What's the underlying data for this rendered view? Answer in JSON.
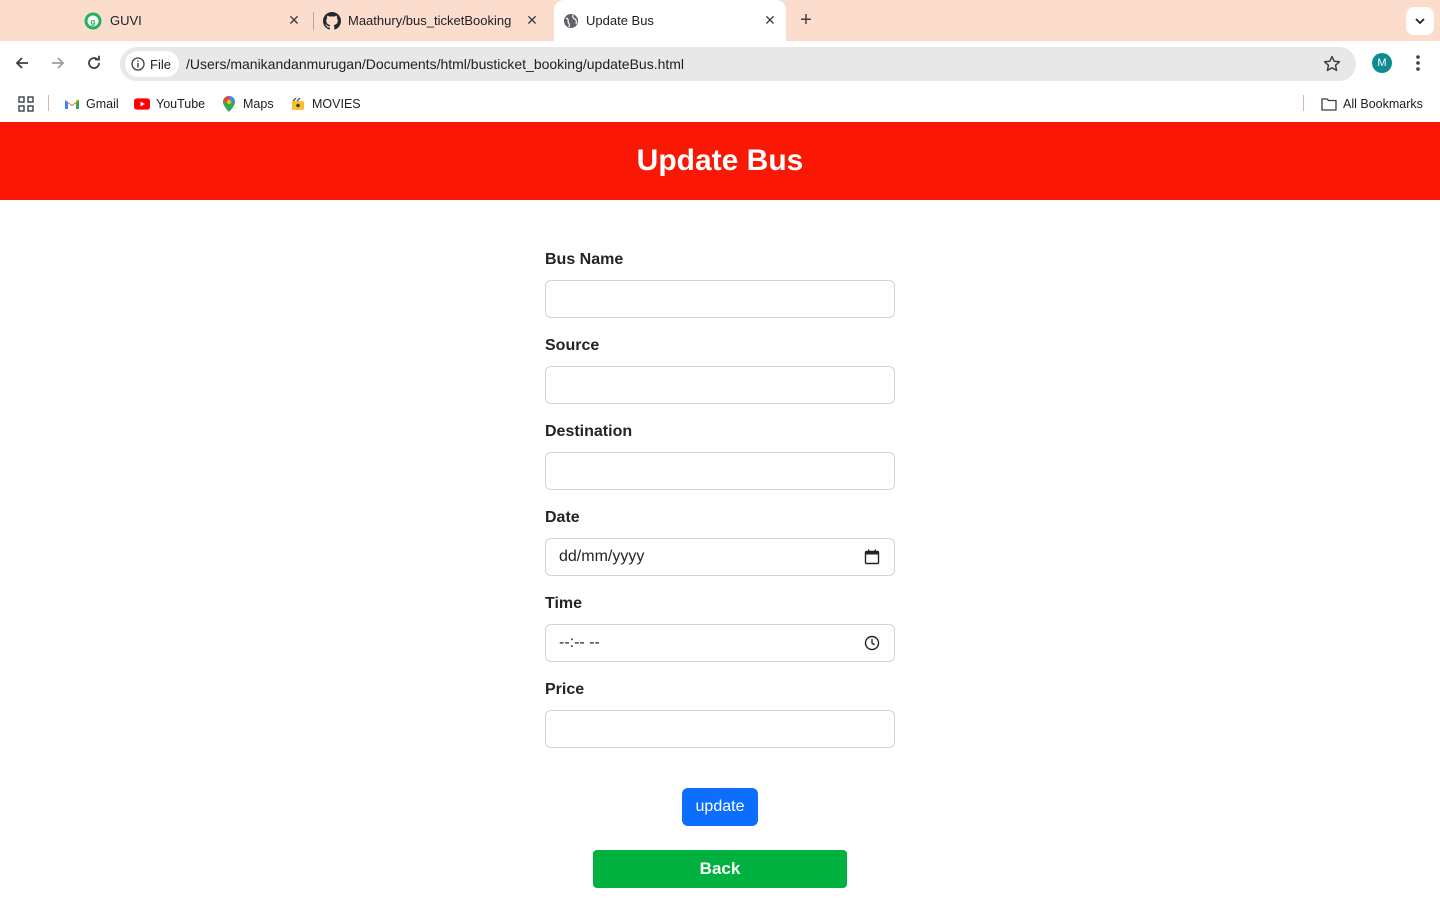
{
  "browser": {
    "tabs": [
      {
        "title": "GUVI",
        "icon": "guvi-logo-icon"
      },
      {
        "title": "Maathury/bus_ticketBooking",
        "icon": "github-icon"
      },
      {
        "title": "Update Bus",
        "icon": "globe-icon",
        "active": true
      }
    ],
    "address": {
      "chip_label": "File",
      "url": "/Users/manikandanmurugan/Documents/html/busticket_booking/updateBus.html"
    },
    "profile_initial": "M",
    "bookmarks": [
      {
        "label": "Gmail",
        "icon": "gmail-icon"
      },
      {
        "label": "YouTube",
        "icon": "youtube-icon"
      },
      {
        "label": "Maps",
        "icon": "maps-icon"
      },
      {
        "label": "MOVIES",
        "icon": "movies-icon"
      }
    ],
    "all_bookmarks_label": "All Bookmarks"
  },
  "page": {
    "title": "Update Bus",
    "fields": {
      "bus_name": {
        "label": "Bus Name",
        "value": ""
      },
      "source": {
        "label": "Source",
        "value": ""
      },
      "destination": {
        "label": "Destination",
        "value": ""
      },
      "date": {
        "label": "Date",
        "placeholder": "dd/mm/yyyy"
      },
      "time": {
        "label": "Time",
        "placeholder": "--:-- --"
      },
      "price": {
        "label": "Price",
        "value": ""
      }
    },
    "update_label": "update",
    "back_label": "Back"
  },
  "colors": {
    "header": "#fa1805",
    "update_button": "#0d6efd",
    "back_button": "#00b140",
    "tab_strip": "#fcdccc"
  }
}
